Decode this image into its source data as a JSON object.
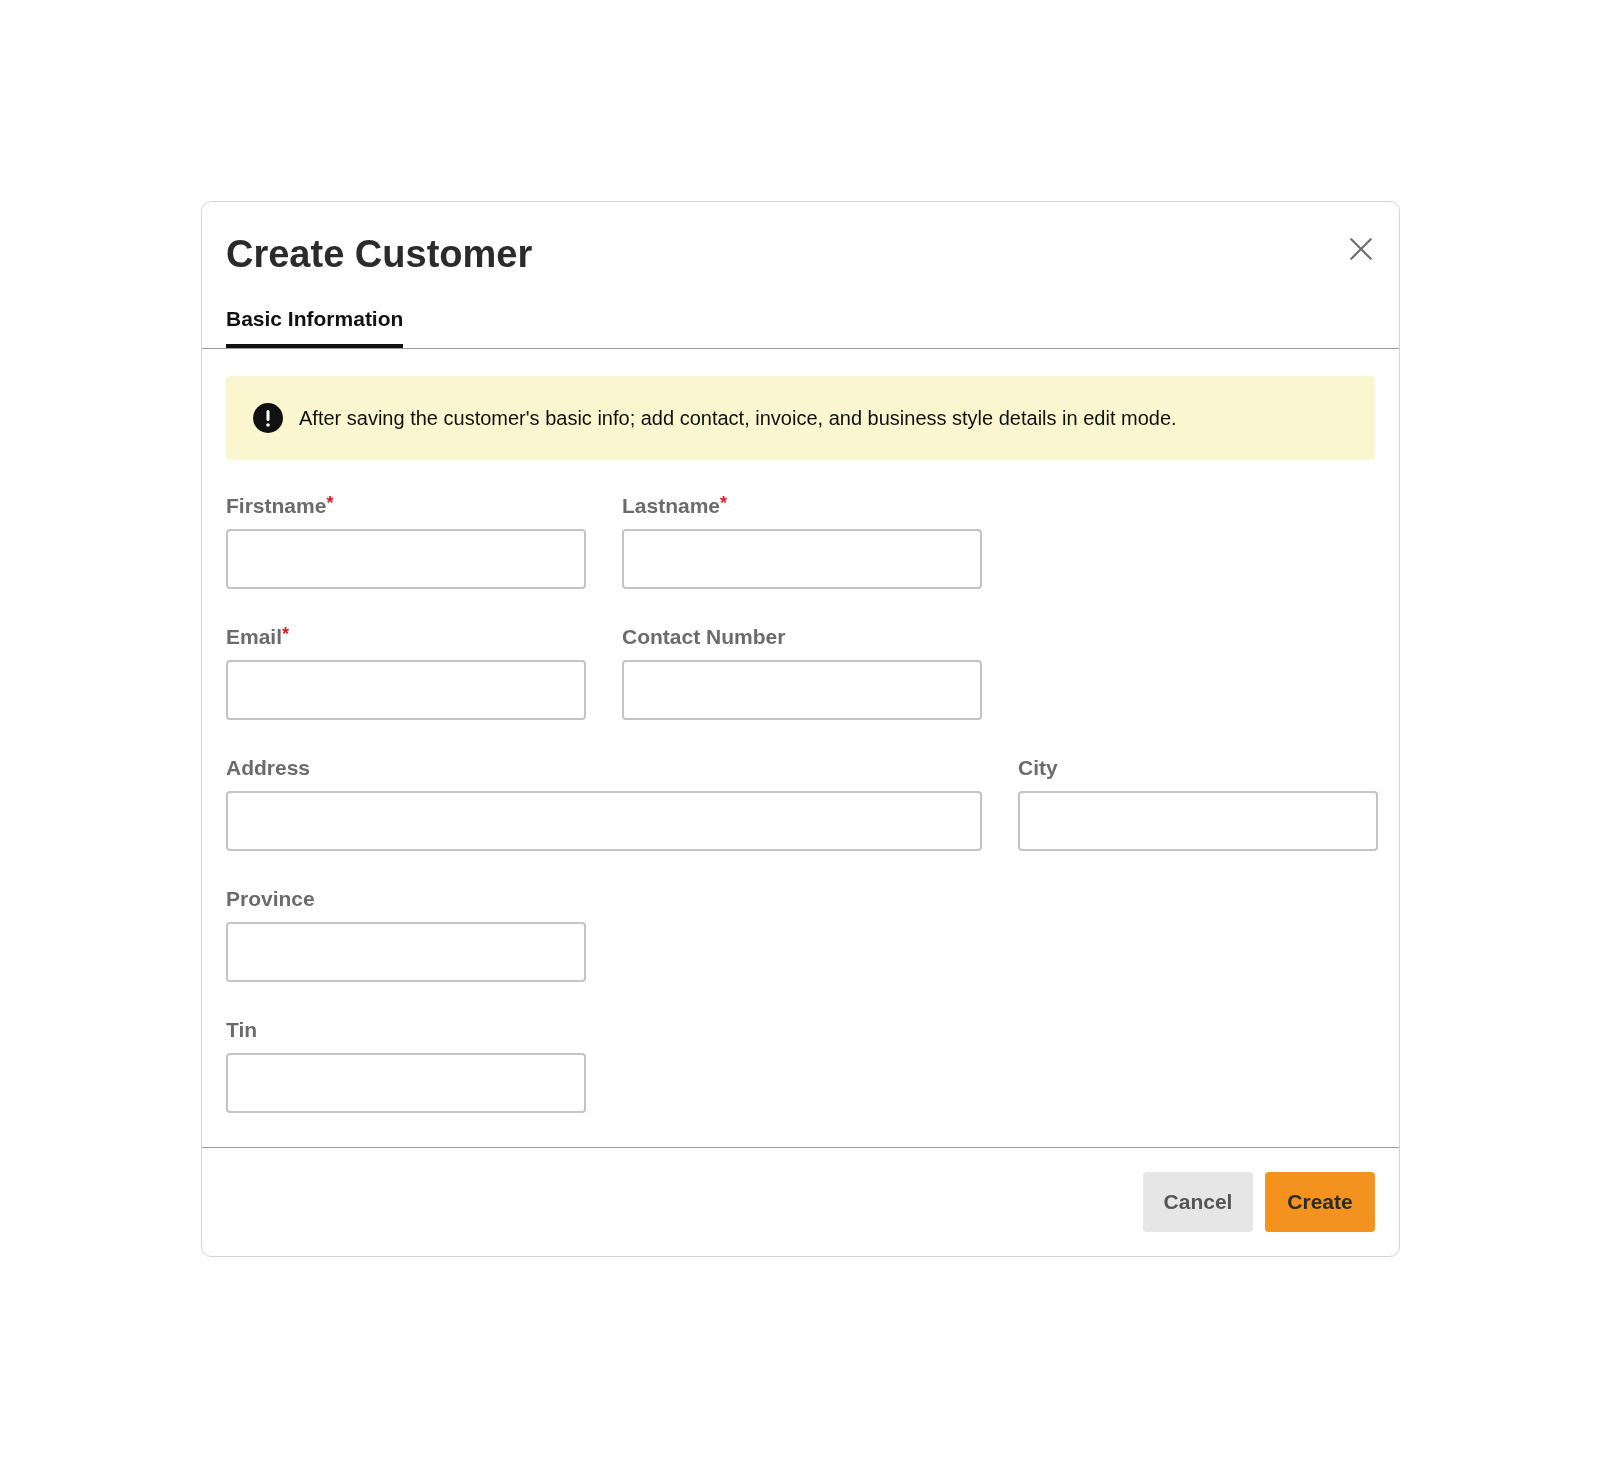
{
  "dialog": {
    "title": "Create Customer"
  },
  "tabs": [
    {
      "label": "Basic Information",
      "selected": true
    }
  ],
  "notice": {
    "text": "After saving the customer's basic info; add contact, invoice, and business style details in edit mode."
  },
  "form_rows": [
    [
      {
        "label": "Firstname",
        "required_mark": "*",
        "wide": false
      },
      {
        "label": "Lastname",
        "required_mark": "*",
        "wide": false
      }
    ],
    [
      {
        "label": "Email",
        "required_mark": "*",
        "wide": false
      },
      {
        "label": "Contact Number",
        "wide": false
      }
    ],
    [
      {
        "label": "Address",
        "wide": true
      },
      {
        "label": "City",
        "wide": false
      }
    ],
    [
      {
        "label": "Province",
        "wide": false
      }
    ],
    [
      {
        "label": "Tin",
        "wide": false
      }
    ]
  ],
  "buttons": [
    {
      "label": "Cancel",
      "kind": "secondary"
    },
    {
      "label": "Create",
      "kind": "primary"
    }
  ]
}
